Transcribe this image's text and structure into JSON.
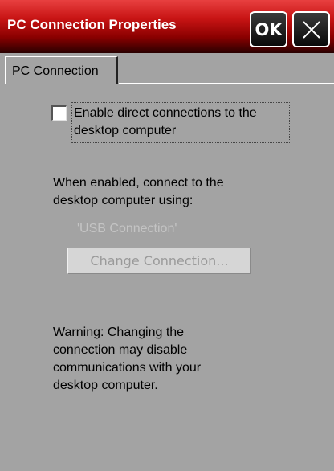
{
  "window": {
    "title": "PC Connection Properties",
    "ok_label": "OK"
  },
  "icons": {
    "close": "close-icon"
  },
  "tabs": [
    {
      "label": "PC Connection",
      "selected": true
    }
  ],
  "settings": {
    "enable_checkbox": {
      "checked": false,
      "label_line1": "Enable direct connections to the",
      "label_line2": "desktop computer"
    },
    "info_line1": "When enabled, connect to the",
    "info_line2": "desktop computer using:",
    "connection_name": "'USB Connection'",
    "change_button_label": "Change Connection...",
    "warning_line1": "Warning: Changing the",
    "warning_line2": "connection may disable",
    "warning_line3": "communications with your",
    "warning_line4": "desktop computer."
  },
  "colors": {
    "titlebar_top": "#e84040",
    "titlebar_bottom": "#2a0000",
    "background": "#a3a3a3",
    "disabled_text": "#c4c4c4"
  }
}
